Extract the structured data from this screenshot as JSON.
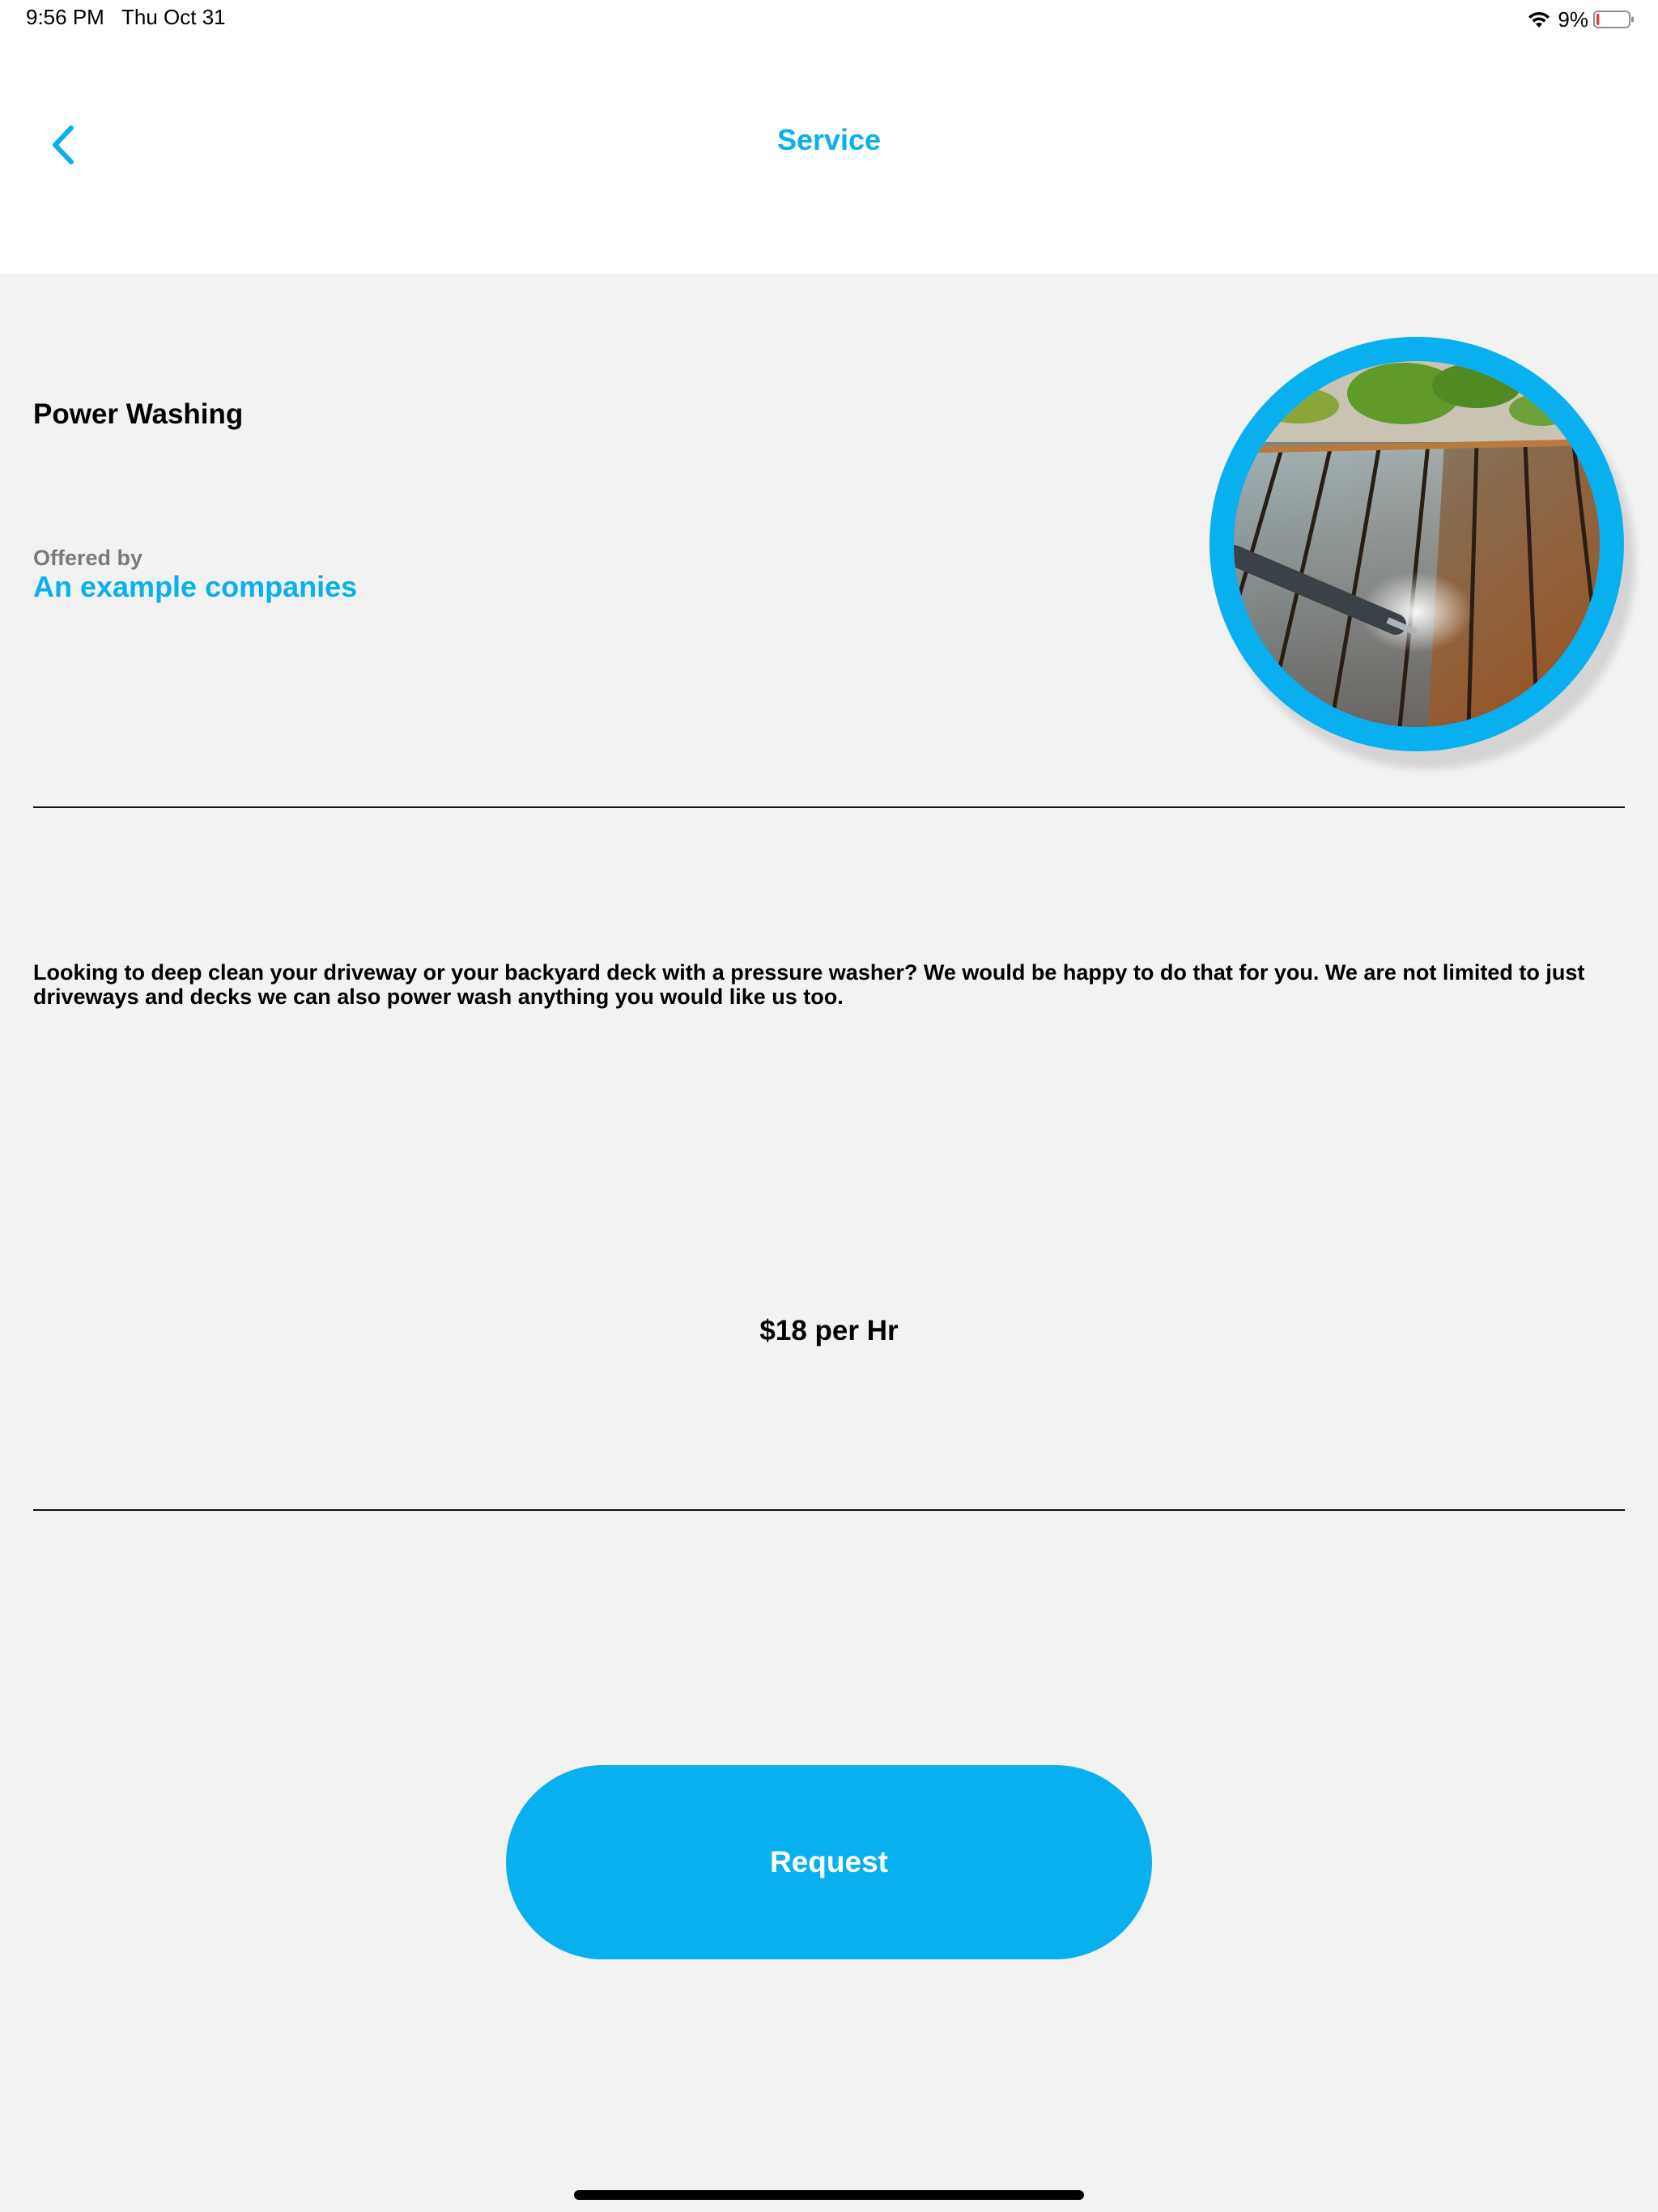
{
  "status_bar": {
    "time": "9:56 PM",
    "date": "Thu Oct 31",
    "battery_percent": "9%",
    "battery_level": 0.09,
    "icons": [
      "wifi-icon",
      "battery-icon"
    ]
  },
  "nav": {
    "title": "Service",
    "back_icon": "chevron-left-icon"
  },
  "service": {
    "name": "Power Washing",
    "offered_label": "Offered by",
    "company": "An example companies",
    "image": "power-washing-deck-photo",
    "description": "Looking to deep clean your driveway or your backyard deck with a pressure washer? We would be happy to do that for you. We are not limited to just driveways and decks we can also power wash anything you would like us too.",
    "price": "$18 per Hr"
  },
  "actions": {
    "request_label": "Request"
  },
  "colors": {
    "accent": "#08b0ef",
    "background": "#f2f2f2",
    "header_bg": "#ffffff",
    "secondary_text": "#7a7a7a"
  }
}
